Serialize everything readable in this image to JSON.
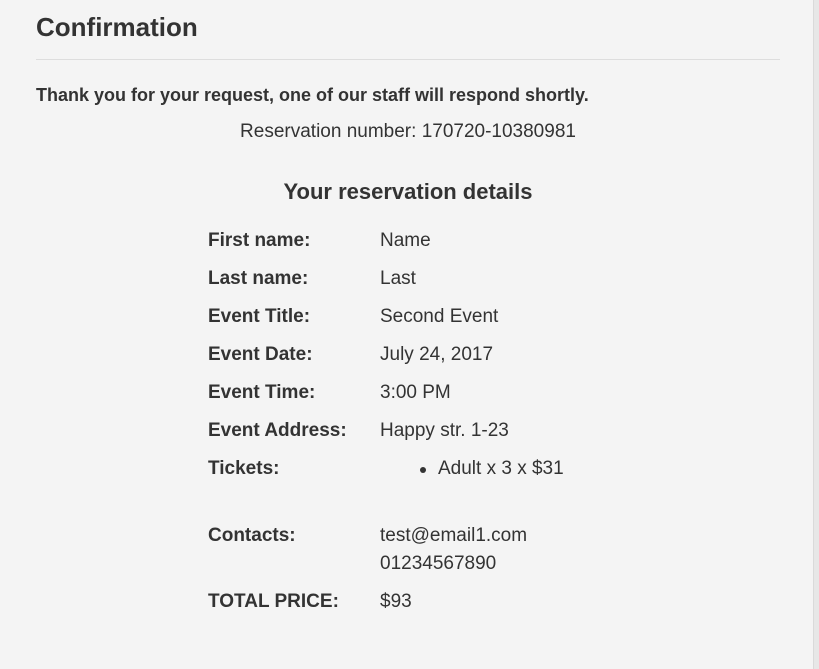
{
  "confirmation": {
    "title": "Confirmation",
    "thank_you_message": "Thank you for your request, one of our staff will respond shortly.",
    "reservation_number_label": "Reservation number: 170720-10380981",
    "details_heading": "Your reservation details"
  },
  "details": {
    "first_name": {
      "label": "First name:",
      "value": "Name"
    },
    "last_name": {
      "label": "Last name:",
      "value": "Last"
    },
    "event_title": {
      "label": "Event Title:",
      "value": "Second Event"
    },
    "event_date": {
      "label": "Event Date:",
      "value": "July 24, 2017"
    },
    "event_time": {
      "label": "Event Time:",
      "value": "3:00 PM"
    },
    "event_address": {
      "label": "Event Address:",
      "value": "Happy str. 1-23"
    },
    "tickets": {
      "label": "Tickets:",
      "items": [
        "Adult x 3 x $31"
      ]
    },
    "contacts": {
      "label": "Contacts:",
      "email": "test@email1.com",
      "phone": "01234567890"
    },
    "total_price": {
      "label": "TOTAL PRICE:",
      "value": "$93"
    }
  }
}
